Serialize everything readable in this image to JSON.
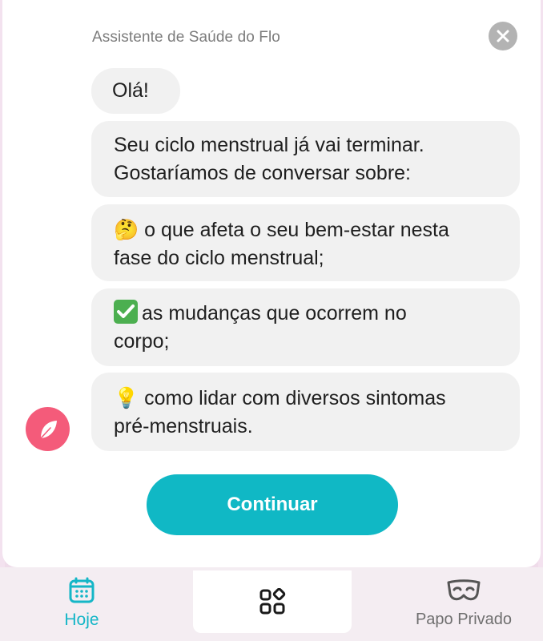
{
  "header": {
    "title": "Assistente de Saúde do Flo"
  },
  "messages": [
    {
      "text": "Olá!"
    },
    {
      "text_line1": "Seu ciclo menstrual já vai terminar.",
      "text_line2": "Gostaríamos de conversar sobre:"
    },
    {
      "emoji": "🤔",
      "text_line1": "o que afeta o seu bem-estar nesta",
      "text_line2": "fase do ciclo menstrual;"
    },
    {
      "emoji": "✅",
      "text_line1": "as mudanças que ocorrem no",
      "text_line2": "corpo;"
    },
    {
      "emoji": "💡",
      "text_line1": "como lidar com diversos sintomas",
      "text_line2": "pré-menstruais."
    }
  ],
  "actions": {
    "continue_label": "Continuar"
  },
  "nav": {
    "today_label": "Hoje",
    "private_label": "Papo Privado"
  },
  "colors": {
    "accent": "#10b8c5",
    "avatar": "#f45b7a",
    "bubble": "#f1f1f1",
    "close": "#b3b3b3"
  },
  "icons": {
    "close": "close-icon",
    "assistant": "flo-feather-icon",
    "today": "calendar-icon",
    "content": "grid-shapes-icon",
    "private": "mask-icon"
  }
}
